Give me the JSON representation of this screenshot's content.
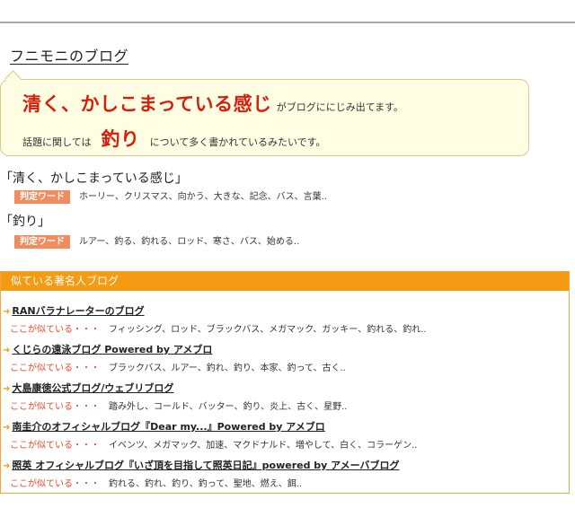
{
  "blog": {
    "title": "フニモニのブログ"
  },
  "summary": {
    "mood_phrase": "清く、かしこまっている感じ",
    "mood_suffix": "がブログににじみ出てます。",
    "topic_prefix": "話題に関しては",
    "topic_word": "釣り",
    "topic_suffix": "について多く書かれているみたいです。"
  },
  "keyword_groups": [
    {
      "title": "「清く、かしこまっている感じ」",
      "tag": "判定ワード",
      "words": "ホーリー、クリスマス、向かう、大きな、記念、バス、言葉.."
    },
    {
      "title": "「釣り」",
      "tag": "判定ワード",
      "words": "ルアー、釣る、釣れる、ロッド、寒さ、バス、始める.."
    }
  ],
  "similar_blogs": {
    "header": "似ている著名人ブログ",
    "similar_label": "ここが似ている・・・",
    "items": [
      {
        "title": "RANバラナレーターのブログ",
        "keywords": "フィッシング、ロッド、ブラックバス、メガマック、ガッキー、釣れる、釣れ.."
      },
      {
        "title": "くじらの遠泳ブログ Powered by アメブロ",
        "keywords": "ブラックバス、ルアー、釣れ、釣り、本家、釣って、古く.."
      },
      {
        "title": "大島康徳公式ブログ/ウェブリブログ",
        "keywords": "踏み外し、コールド、バッター、釣り、炎上、古く、星野.."
      },
      {
        "title": "南圭介のオフィシャルブログ『Dear my...』Powered by アメブロ",
        "keywords": "イベンツ、メガマック、加速、マクドナルド、増やして、白く、コラーゲン.."
      },
      {
        "title": "照英 オフィシャルブログ『いざ頂を目指して照英日記』powered by アメーバブログ",
        "keywords": "釣れる、釣れ、釣り、釣って、聖地、燃え、餌.."
      }
    ]
  },
  "colors": {
    "accent_red": "#d51f0c",
    "orange": "#f49a13",
    "tag_bg": "#f08c60",
    "bubble_bg": "#fffde2"
  }
}
